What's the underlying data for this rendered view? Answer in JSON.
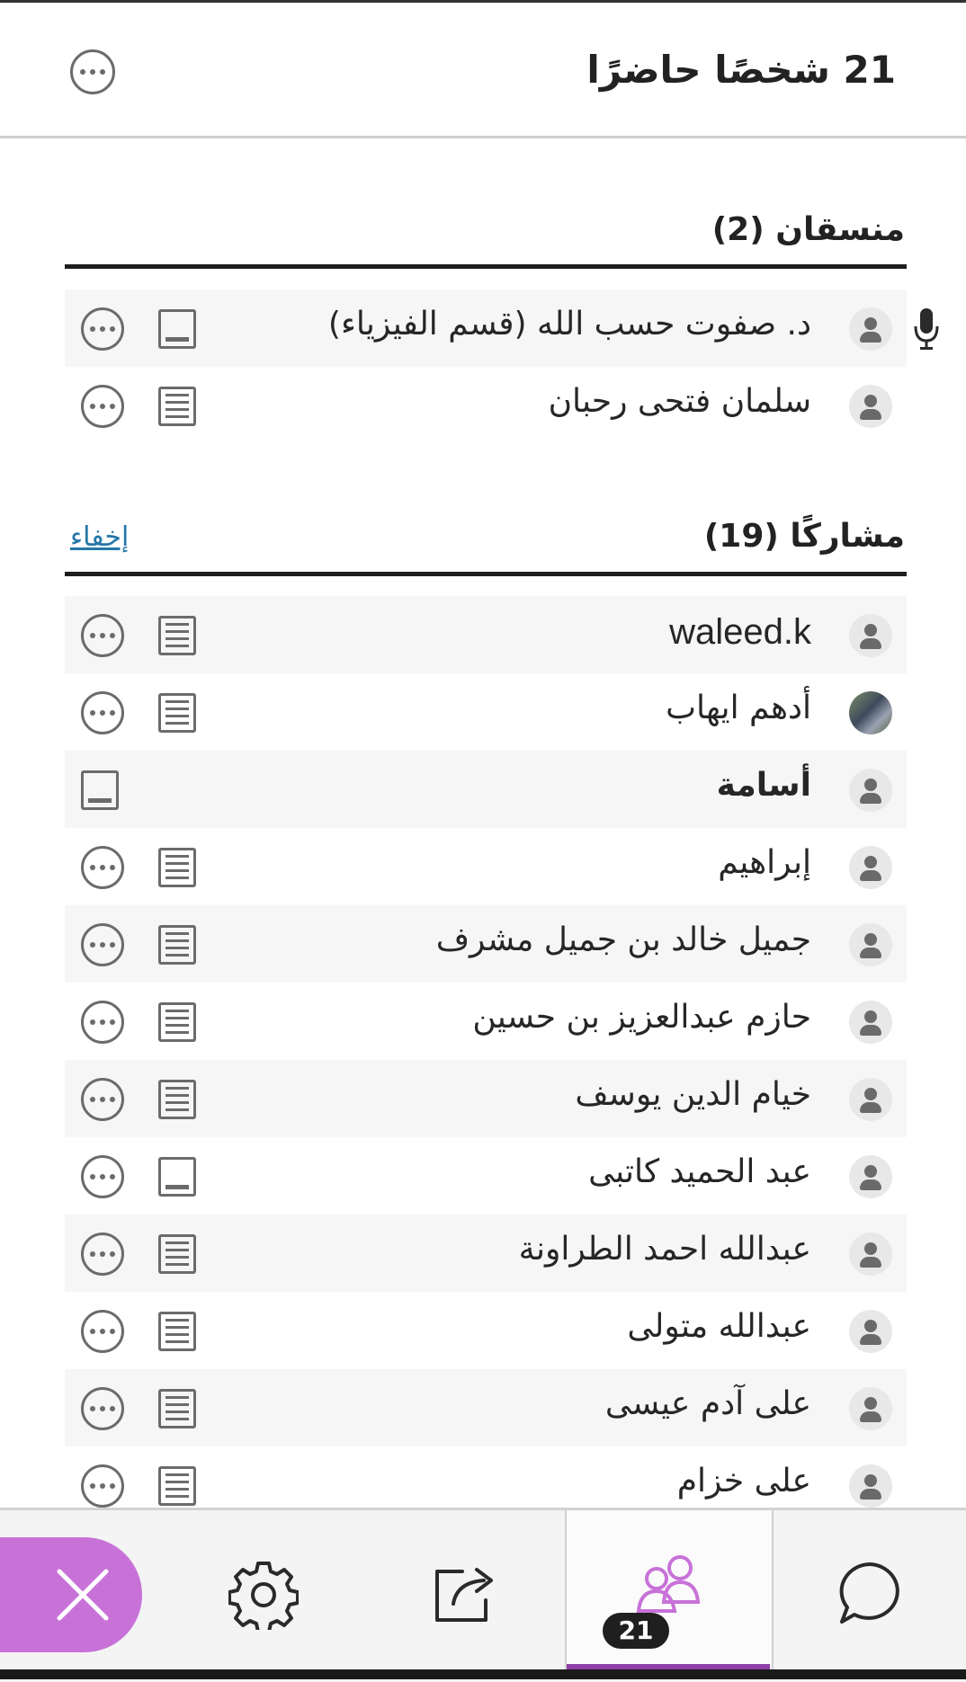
{
  "header": {
    "title": "21 شخصًا حاضرًا"
  },
  "moderators": {
    "title": "منسقان (2)",
    "items": [
      {
        "name": "د. صفوت حسب الله (قسم الفيزياء)",
        "talking": true,
        "captions": "off"
      },
      {
        "name": "سلمان فتحى رحبان",
        "talking": false,
        "captions": "on"
      }
    ]
  },
  "participants": {
    "title": "مشاركًا (19)",
    "hide_label": "إخفاء",
    "items": [
      {
        "name": "waleed.k",
        "avatar": "default"
      },
      {
        "name": "أدهم ايهاب",
        "avatar": "photo"
      },
      {
        "name": "أسامة",
        "avatar": "default",
        "self": true
      },
      {
        "name": "إبراهيم",
        "avatar": "default"
      },
      {
        "name": "جميل خالد بن جميل مشرف",
        "avatar": "default"
      },
      {
        "name": "حازم عبدالعزيز بن حسين",
        "avatar": "default"
      },
      {
        "name": "خيام الدين يوسف",
        "avatar": "default"
      },
      {
        "name": "عبد الحميد كاتبى",
        "avatar": "default",
        "captions": "off"
      },
      {
        "name": "عبدالله احمد الطراونة",
        "avatar": "default"
      },
      {
        "name": "عبدالله متولى",
        "avatar": "default"
      },
      {
        "name": "على آدم عيسى",
        "avatar": "default"
      },
      {
        "name": "على خزام",
        "avatar": "default"
      }
    ]
  },
  "tabs": {
    "items": [
      "close",
      "settings",
      "share-content",
      "attendees",
      "chat"
    ],
    "active": "attendees",
    "attendees_count": "21"
  },
  "colors": {
    "accent": "#c872d8",
    "active_underline": "#8e3fa7",
    "link": "#2377a8"
  }
}
